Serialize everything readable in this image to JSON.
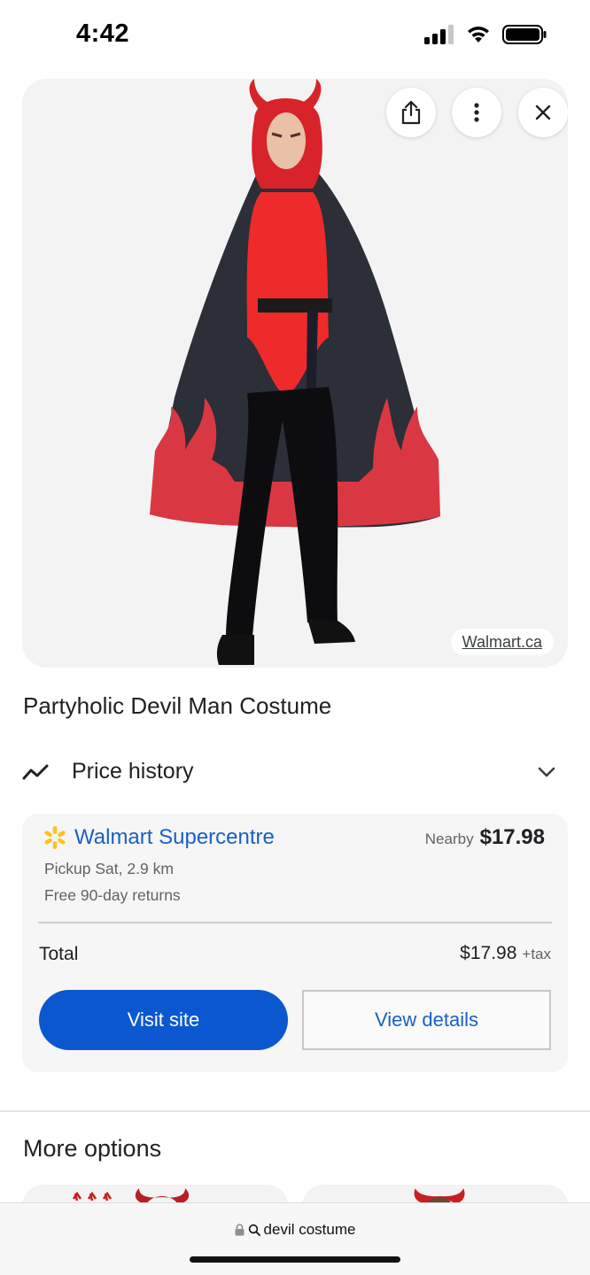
{
  "status_bar": {
    "time": "4:42"
  },
  "product": {
    "image_source": "Walmart.ca",
    "title": "Partyholic Devil Man Costume"
  },
  "price_history": {
    "label": "Price history"
  },
  "offer": {
    "store": "Walmart Supercentre",
    "nearby_label": "Nearby",
    "price": "$17.98",
    "pickup": "Pickup Sat, 2.9 km",
    "returns": "Free 90-day returns",
    "total_label": "Total",
    "total_price": "$17.98",
    "tax": "+tax",
    "visit_label": "Visit site",
    "details_label": "View details"
  },
  "more_options": {
    "heading": "More options"
  },
  "browser": {
    "query": "devil costume"
  },
  "colors": {
    "accent": "#0b57d0",
    "link": "#1a5fc4",
    "walmart_spark": "#ffc220"
  },
  "icons": [
    "share-icon",
    "more-vert-icon",
    "close-icon",
    "trending-icon",
    "chevron-down-icon",
    "walmart-spark-icon",
    "lock-icon",
    "search-icon"
  ]
}
